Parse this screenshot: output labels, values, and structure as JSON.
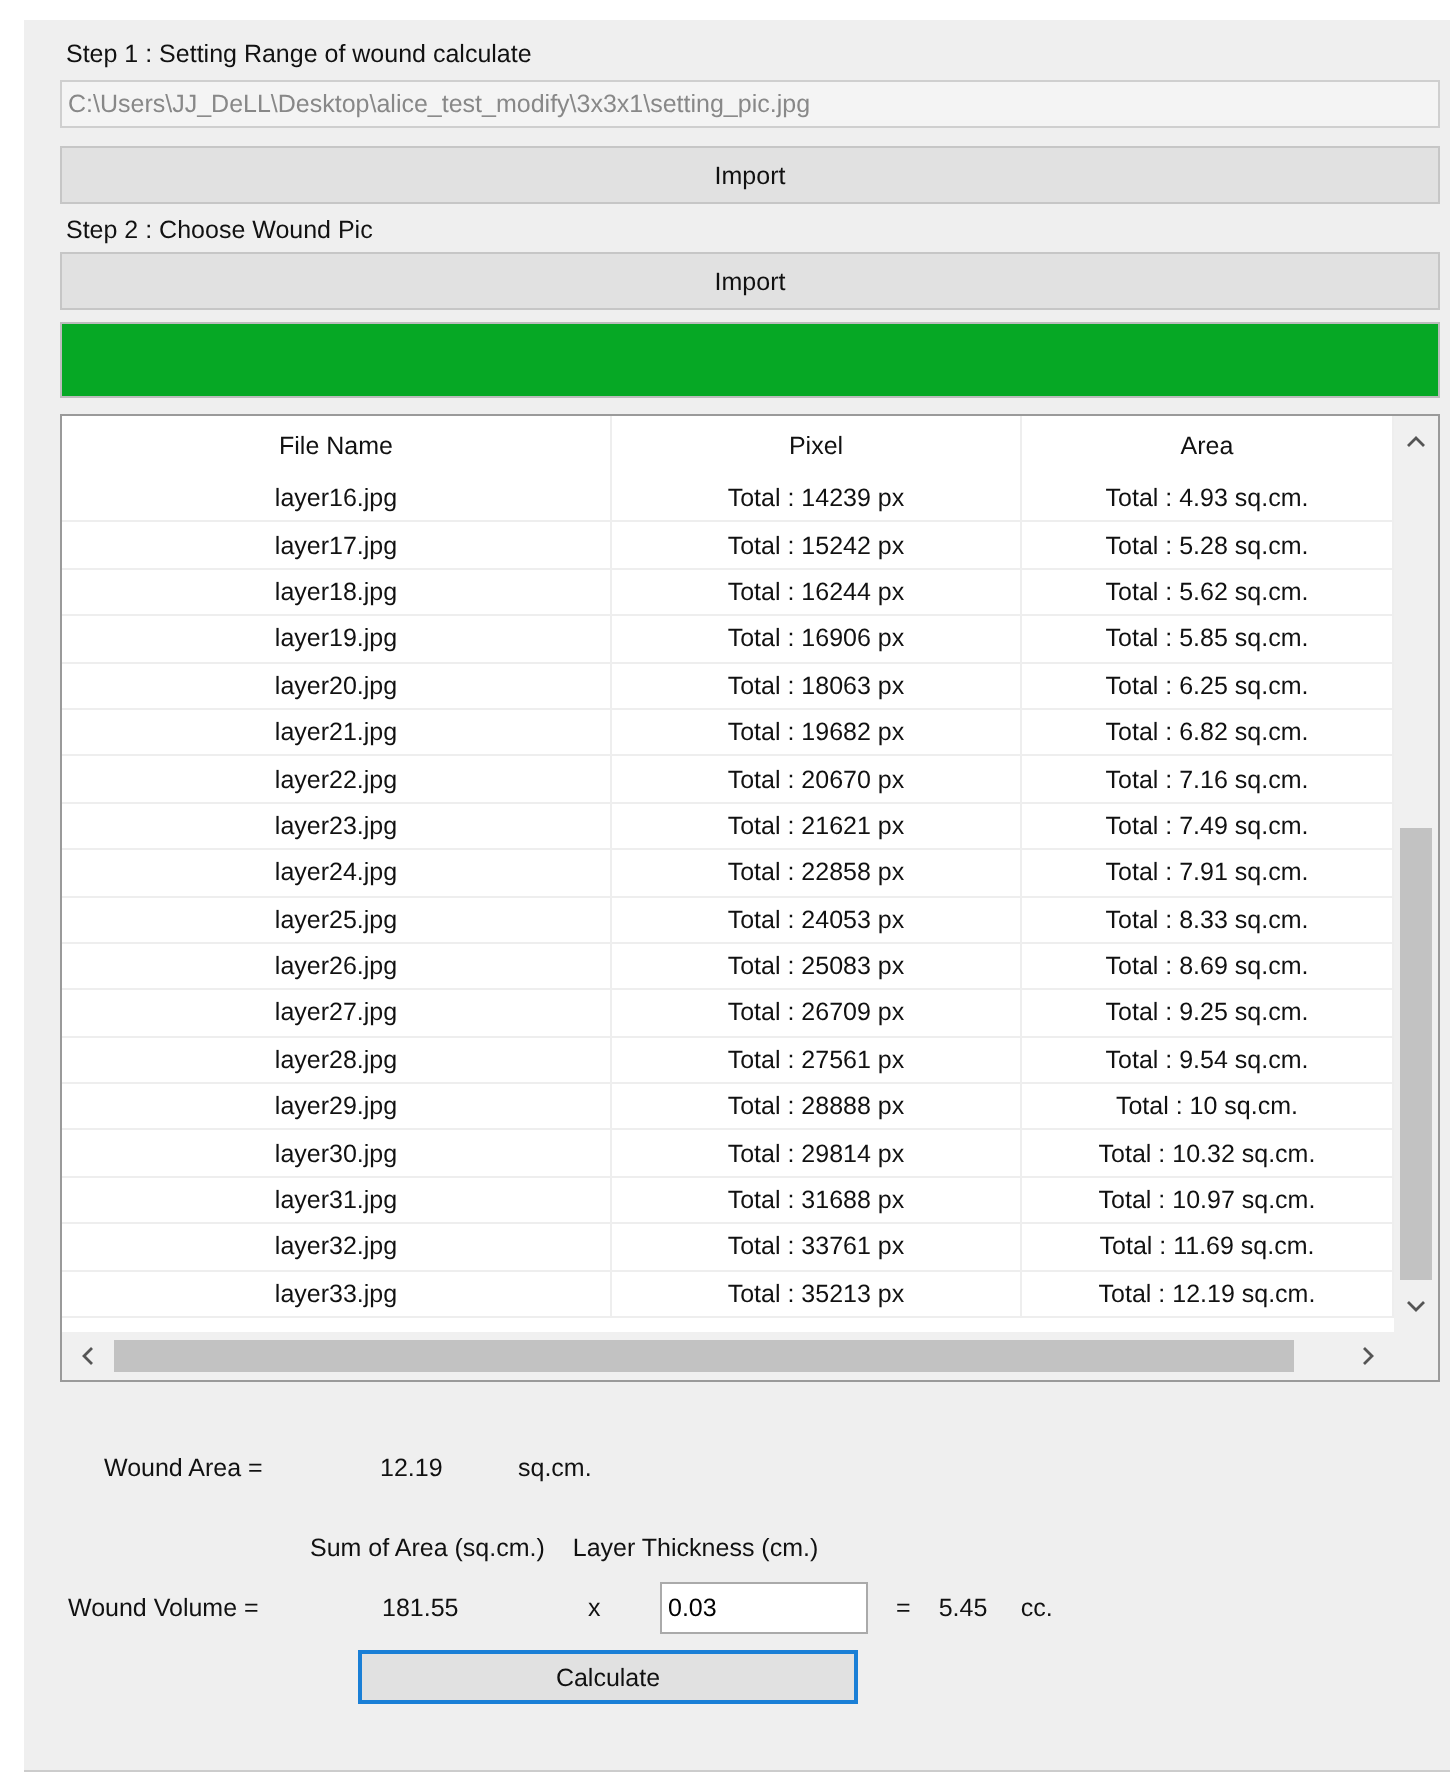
{
  "step1": {
    "label": "Step 1 : Setting  Range of wound calculate",
    "path": "C:\\Users\\JJ_DeLL\\Desktop\\alice_test_modify\\3x3x1\\setting_pic.jpg",
    "button": "Import"
  },
  "step2": {
    "label": "Step 2 : Choose Wound Pic",
    "button": "Import"
  },
  "progress": {
    "level": 1
  },
  "table": {
    "columns": [
      "File Name",
      "Pixel",
      "Area"
    ],
    "rows": [
      [
        "layer16.jpg",
        "Total : 14239 px",
        "Total : 4.93 sq.cm."
      ],
      [
        "layer17.jpg",
        "Total : 15242 px",
        "Total : 5.28 sq.cm."
      ],
      [
        "layer18.jpg",
        "Total : 16244 px",
        "Total : 5.62 sq.cm."
      ],
      [
        "layer19.jpg",
        "Total : 16906 px",
        "Total : 5.85 sq.cm."
      ],
      [
        "layer20.jpg",
        "Total : 18063 px",
        "Total : 6.25 sq.cm."
      ],
      [
        "layer21.jpg",
        "Total : 19682 px",
        "Total : 6.82 sq.cm."
      ],
      [
        "layer22.jpg",
        "Total : 20670 px",
        "Total : 7.16 sq.cm."
      ],
      [
        "layer23.jpg",
        "Total : 21621 px",
        "Total : 7.49 sq.cm."
      ],
      [
        "layer24.jpg",
        "Total : 22858 px",
        "Total : 7.91 sq.cm."
      ],
      [
        "layer25.jpg",
        "Total : 24053 px",
        "Total : 8.33 sq.cm."
      ],
      [
        "layer26.jpg",
        "Total : 25083 px",
        "Total : 8.69 sq.cm."
      ],
      [
        "layer27.jpg",
        "Total : 26709 px",
        "Total : 9.25 sq.cm."
      ],
      [
        "layer28.jpg",
        "Total : 27561 px",
        "Total : 9.54 sq.cm."
      ],
      [
        "layer29.jpg",
        "Total : 28888 px",
        "Total : 10 sq.cm."
      ],
      [
        "layer30.jpg",
        "Total : 29814 px",
        "Total : 10.32 sq.cm."
      ],
      [
        "layer31.jpg",
        "Total : 31688 px",
        "Total : 10.97 sq.cm."
      ],
      [
        "layer32.jpg",
        "Total : 33761 px",
        "Total : 11.69 sq.cm."
      ],
      [
        "layer33.jpg",
        "Total : 35213 px",
        "Total : 12.19 sq.cm."
      ]
    ]
  },
  "wound_area": {
    "label": "Wound Area =",
    "value": "12.19",
    "unit": "sq.cm."
  },
  "volume": {
    "sum_heading": "Sum of Area (sq.cm.)",
    "thickness_heading": "Layer Thickness (cm.)",
    "label": "Wound Volume =",
    "sum": "181.55",
    "times": "x",
    "thickness": "0.03",
    "equals": "=",
    "result": "5.45",
    "unit": "cc."
  },
  "calculate_button": "Calculate"
}
